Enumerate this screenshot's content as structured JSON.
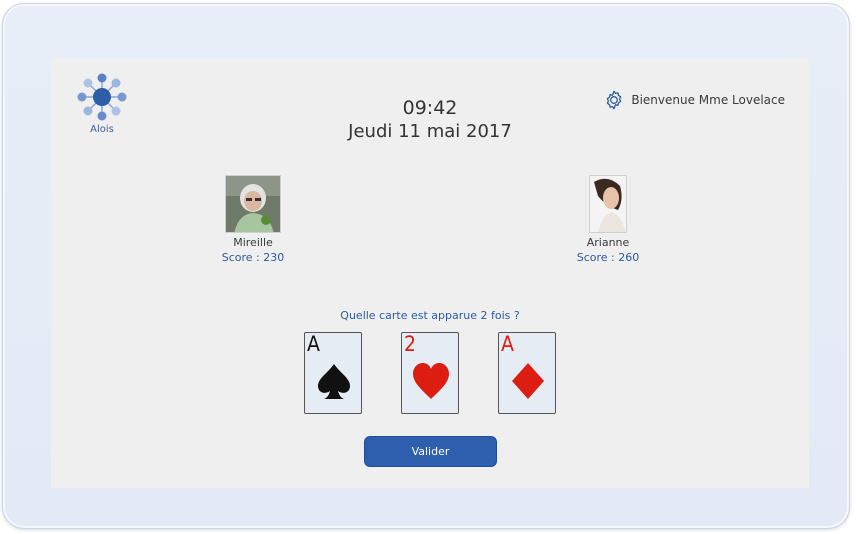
{
  "app": {
    "logo_label": "Alois"
  },
  "header": {
    "time": "09:42",
    "date": "Jeudi 11 mai 2017",
    "welcome": "Bienvenue Mme Lovelace"
  },
  "players": [
    {
      "name": "Mireille",
      "score": "Score : 230"
    },
    {
      "name": "Arianne",
      "score": "Score : 260"
    }
  ],
  "game": {
    "question": "Quelle carte est apparue 2 fois ?",
    "cards": [
      {
        "rank": "A",
        "suit": "spade-icon",
        "color": "#111111"
      },
      {
        "rank": "2",
        "suit": "heart-icon",
        "color": "#dd1c12"
      },
      {
        "rank": "A",
        "suit": "diamond-icon",
        "color": "#dd1c12"
      }
    ],
    "validate_label": "Valider"
  },
  "colors": {
    "accent": "#2e5fae",
    "text_blue": "#2c5aa0",
    "screen_bg": "#efefef"
  }
}
